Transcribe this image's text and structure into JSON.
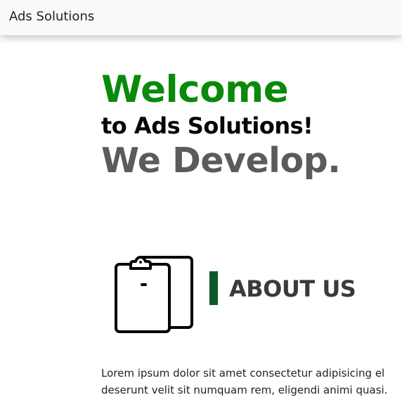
{
  "navbar": {
    "brand": "Ads Solutions"
  },
  "hero": {
    "welcome": "Welcome",
    "subtitle": "to Ads Solutions!",
    "tagline": "We Develop."
  },
  "about": {
    "icon": "clipboard-icon",
    "title": "ABOUT US",
    "text_line1": "Lorem ipsum dolor sit amet consectetur adipisicing el",
    "text_line2": "deserunt velit sit numquam rem, eligendi animi quasi."
  },
  "colors": {
    "welcome": "#0a8a0a",
    "tagline": "#5b5b5b",
    "about_bar": "#0b5a2a",
    "navbar_bg": "#f8f9fb"
  }
}
